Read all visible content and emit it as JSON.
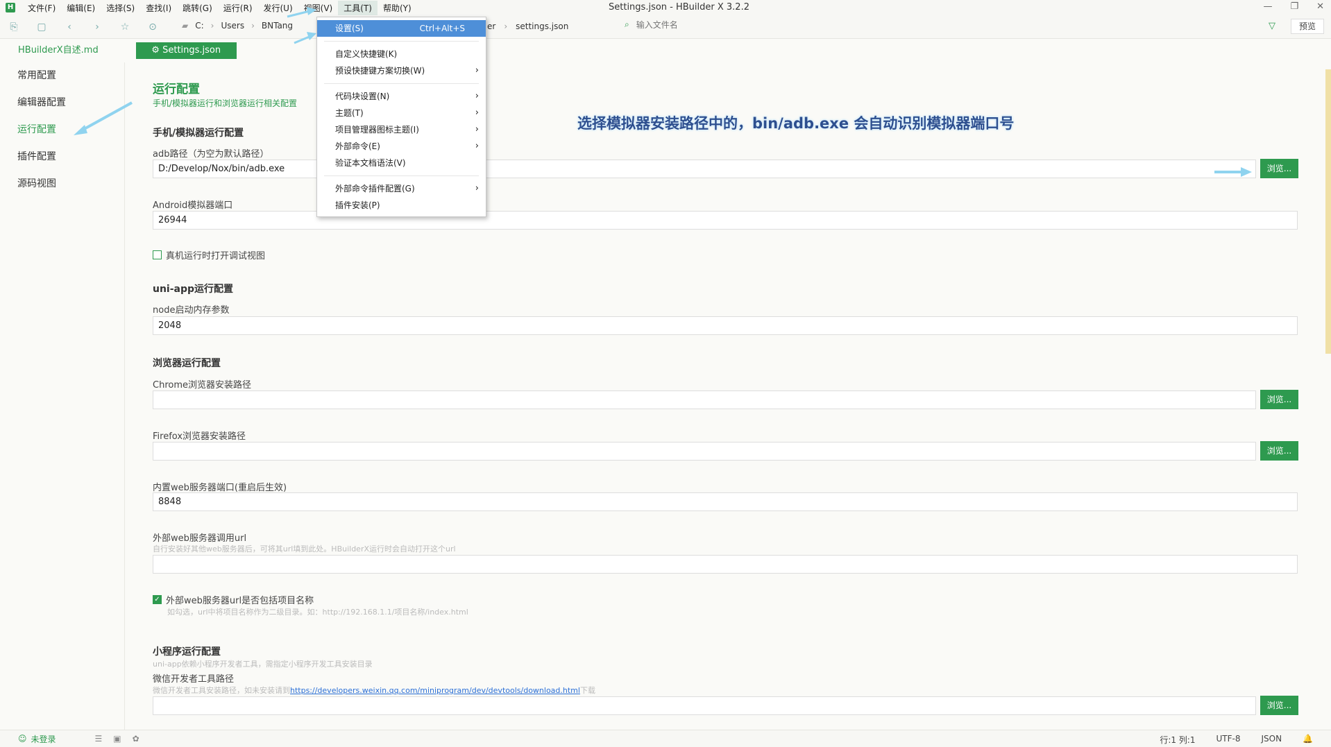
{
  "window": {
    "title": "Settings.json - HBuilder X 3.2.2",
    "controls": {
      "minimize": "—",
      "restore": "❐",
      "close": "✕"
    }
  },
  "menubar": {
    "logo": "H",
    "items": [
      "文件(F)",
      "编辑(E)",
      "选择(S)",
      "查找(I)",
      "跳转(G)",
      "运行(R)",
      "发行(U)",
      "视图(V)",
      "工具(T)",
      "帮助(Y)"
    ]
  },
  "toolbar": {
    "breadcrumb": [
      "C:",
      "Users",
      "BNTang"
    ],
    "breadcrumb_tail": [
      "er",
      "settings.json"
    ],
    "file_search_placeholder": "输入文件名",
    "preview_label": "预览"
  },
  "tabs": [
    {
      "label": "HBuilderX自述.md"
    },
    {
      "label": "Settings.json",
      "icon": "gear-icon"
    }
  ],
  "sidebar": {
    "items": [
      "常用配置",
      "编辑器配置",
      "运行配置",
      "插件配置",
      "源码视图"
    ],
    "active_index": 2
  },
  "annotation_text": "选择模拟器安装路径中的，bin/adb.exe 会自动识别模拟器端口号",
  "content": {
    "title": "运行配置",
    "subtitle": "手机/模拟器运行和浏览器运行相关配置",
    "section_mobile": "手机/模拟器运行配置",
    "adb_label": "adb路径（为空为默认路径）",
    "adb_value": "D:/Develop/Nox/bin/adb.exe",
    "android_port_label": "Android模拟器端口",
    "android_port_value": "26944",
    "debug_view_checkbox": "真机运行时打开调试视图",
    "section_uniapp": "uni-app运行配置",
    "node_mem_label": "node启动内存参数",
    "node_mem_value": "2048",
    "section_browser": "浏览器运行配置",
    "chrome_label": "Chrome浏览器安装路径",
    "firefox_label": "Firefox浏览器安装路径",
    "web_port_label": "内置web服务器端口(重启后生效)",
    "web_port_value": "8848",
    "ext_url_label": "外部web服务器调用url",
    "ext_url_hint": "自行安装好其他web服务器后，可将其url填到此处。HBuilderX运行时会自动打开这个url",
    "ext_url_include_checkbox": "外部web服务器url是否包括项目名称",
    "ext_url_include_hint": "如勾选，url中将项目名称作为二级目录。如：http://192.168.1.1/项目名称/index.html",
    "section_miniprogram": "小程序运行配置",
    "miniprogram_hint": "uni-app依赖小程序开发者工具，需指定小程序开发工具安装目录",
    "wechat_label": "微信开发者工具路径",
    "wechat_hint_prefix": "微信开发者工具安装路径，如未安装请到",
    "wechat_hint_link": "https://developers.weixin.qq.com/miniprogram/dev/devtools/download.html",
    "wechat_hint_suffix": "下载",
    "browse_label": "浏览..."
  },
  "dropdown": {
    "items": [
      {
        "label": "设置(S)",
        "shortcut": "Ctrl+Alt+S",
        "highlighted": true
      },
      {
        "separator": true
      },
      {
        "label": "自定义快捷键(K)"
      },
      {
        "label": "预设快捷键方案切换(W)",
        "submenu": true
      },
      {
        "separator": true
      },
      {
        "label": "代码块设置(N)",
        "submenu": true
      },
      {
        "label": "主题(T)",
        "submenu": true
      },
      {
        "label": "项目管理器图标主题(I)",
        "submenu": true
      },
      {
        "label": "外部命令(E)",
        "submenu": true
      },
      {
        "label": "验证本文档语法(V)"
      },
      {
        "separator": true
      },
      {
        "label": "外部命令插件配置(G)",
        "submenu": true
      },
      {
        "label": "插件安装(P)"
      }
    ]
  },
  "statusbar": {
    "login": "未登录",
    "position": "行:1  列:1",
    "encoding": "UTF-8",
    "language": "JSON"
  },
  "colors": {
    "accent": "#2e9a4f",
    "menu_highlight": "#4e8fd8",
    "annotation_arrow": "#8fd3ef"
  }
}
